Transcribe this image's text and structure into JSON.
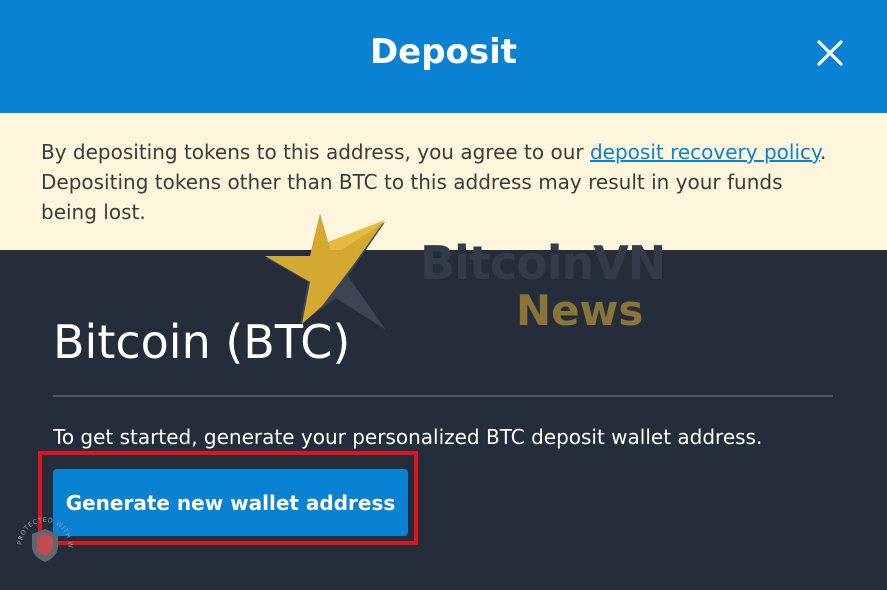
{
  "header": {
    "title": "Deposit",
    "close_icon": "close-icon"
  },
  "notice": {
    "text_before_link": "By depositing tokens to this address, you agree to our ",
    "link_text": "deposit recovery policy",
    "text_after_link": ". Depositing tokens other than BTC to this address may result in your funds being lost."
  },
  "watermark": {
    "line1": "BitcoinVN",
    "line2": "News",
    "logo_icon": "star-logo-icon"
  },
  "main": {
    "coin_title": "Bitcoin (BTC)",
    "instruction": "To get started, generate your personalized BTC deposit wallet address.",
    "generate_button_label": "Generate new wallet address"
  },
  "badge": {
    "arc_text": "PROTECTED WITH WATERMARKLY",
    "icon": "shield-icon"
  },
  "colors": {
    "header_bg": "#0a82d4",
    "notice_bg": "#fdf6dd",
    "panel_bg": "#252d3a",
    "button_bg": "#0a82d4",
    "highlight_border": "#e0141f"
  }
}
